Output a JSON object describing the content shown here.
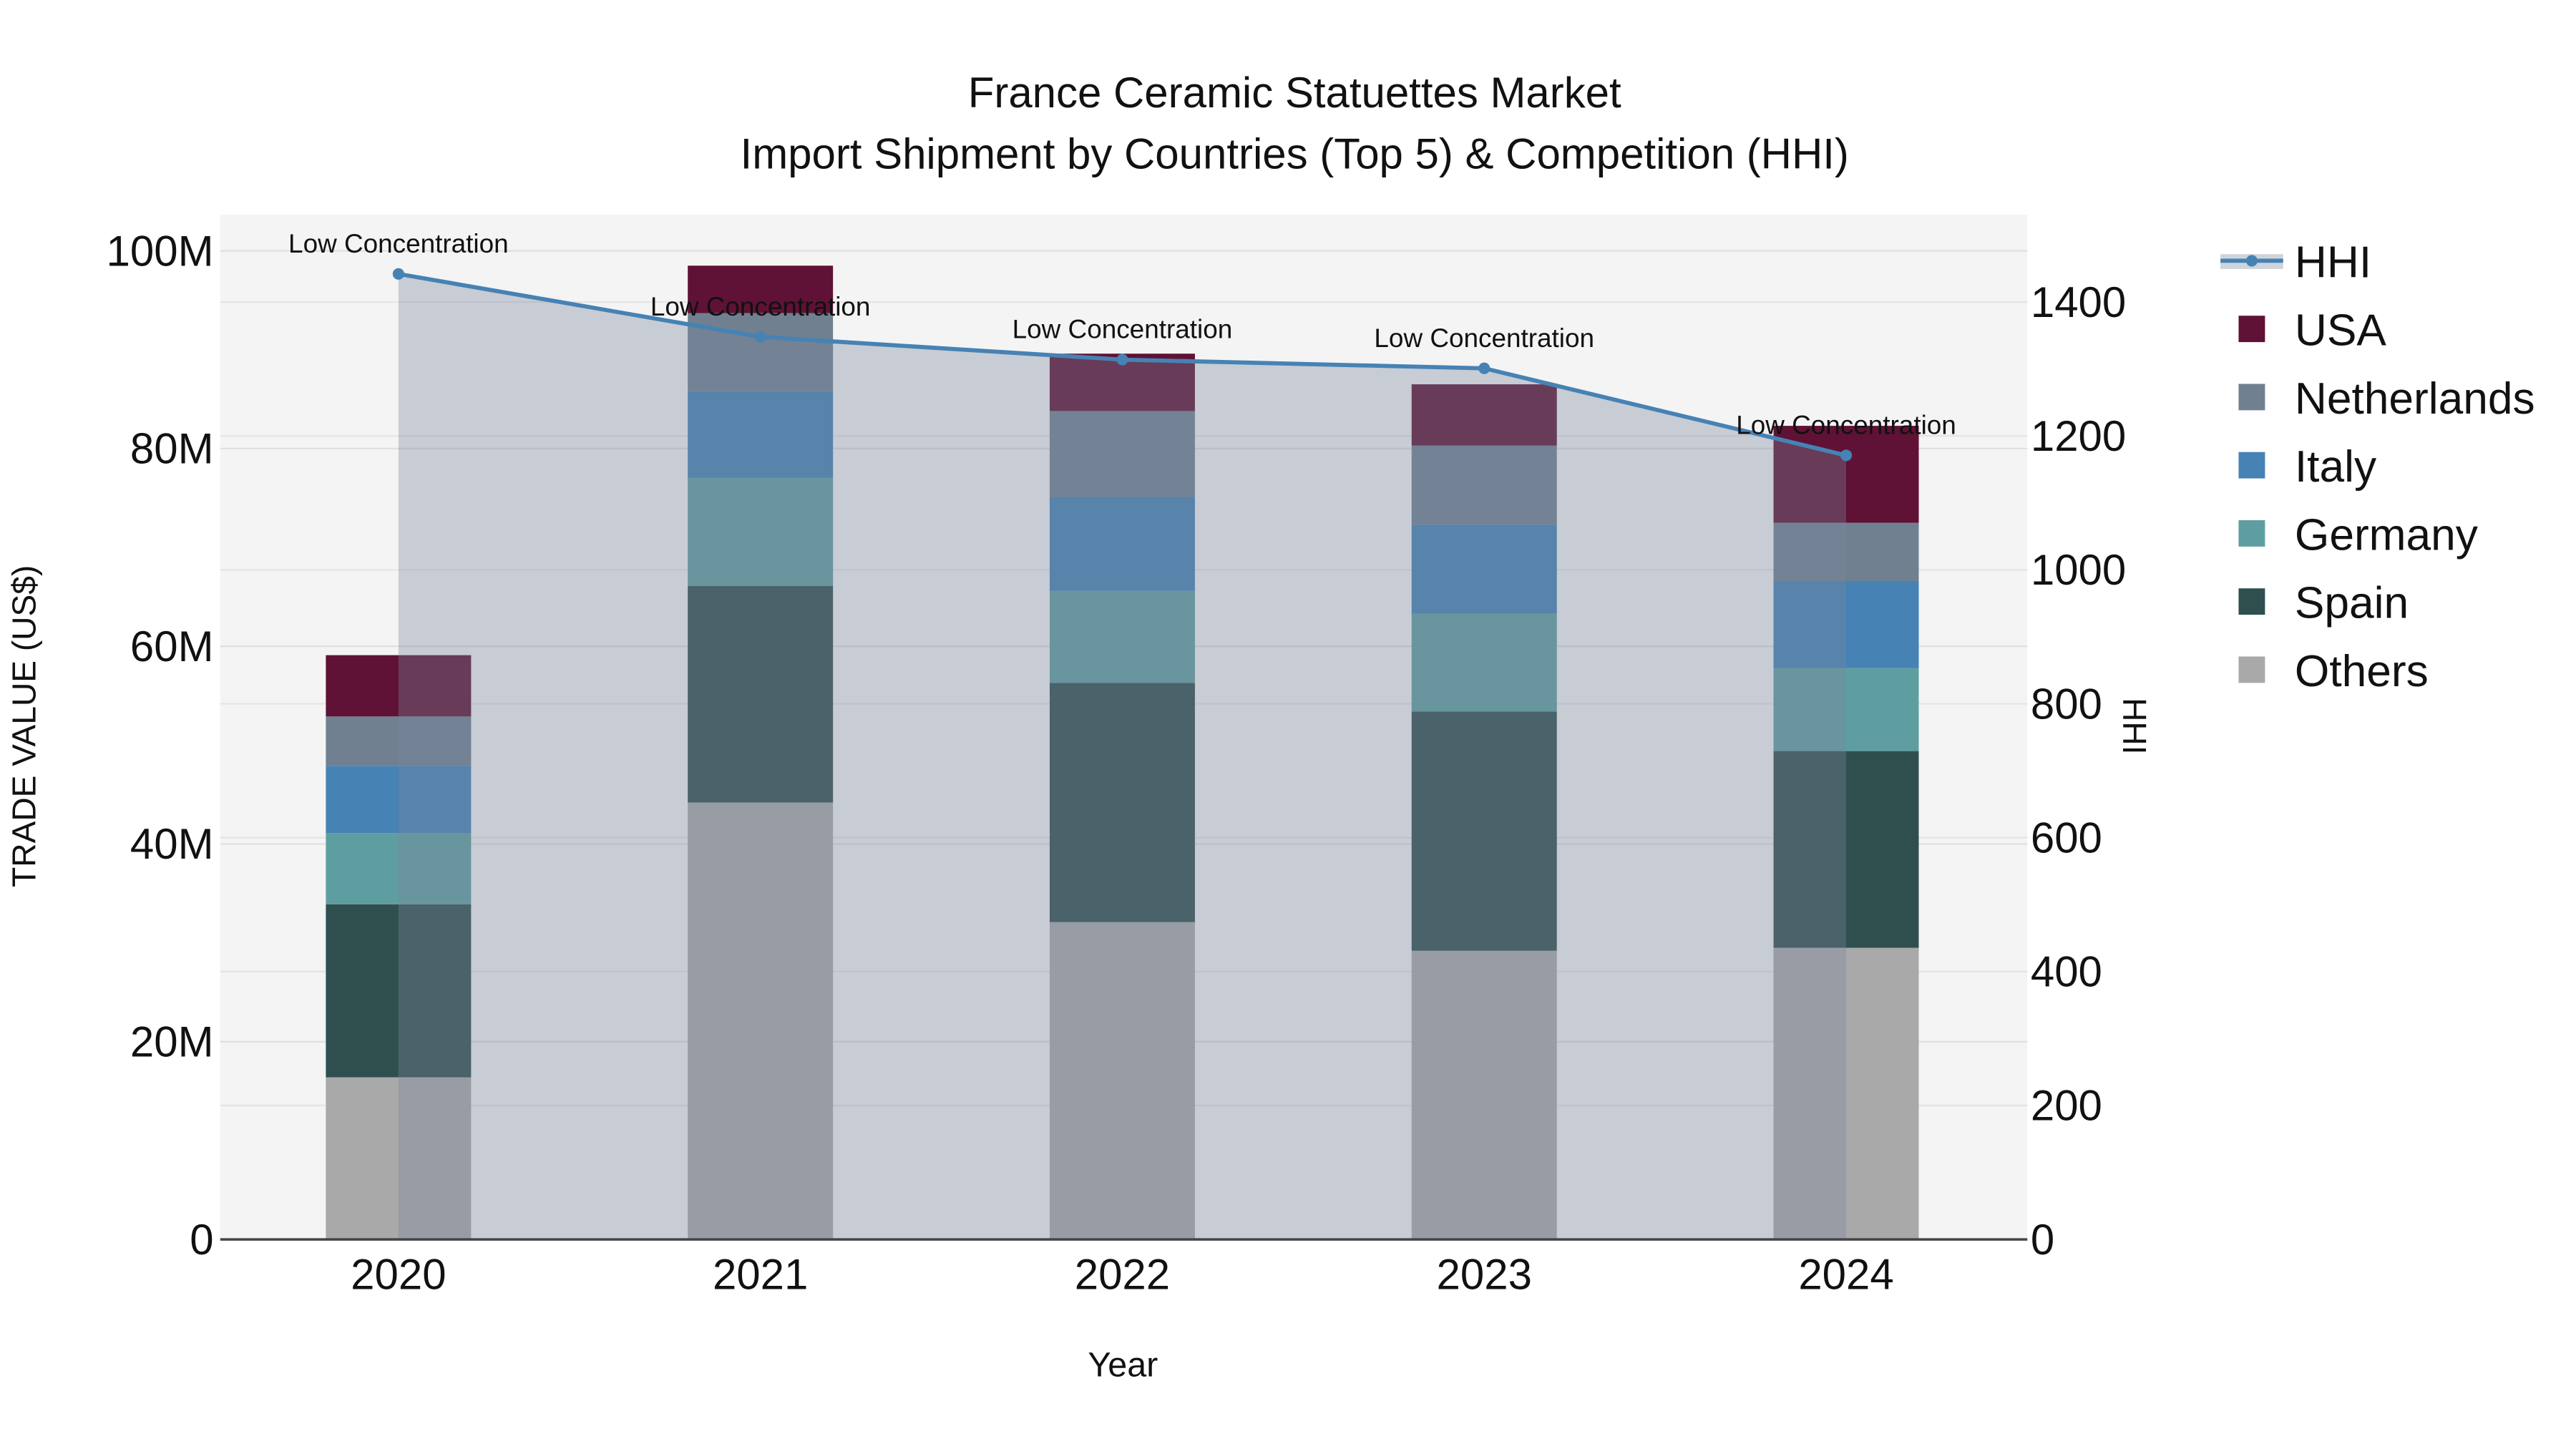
{
  "chart_data": {
    "type": "bar",
    "stacked": true,
    "title_line1": "France Ceramic Statuettes Market",
    "title_line2": "Import Shipment by Countries (Top 5) & Competition (HHI)",
    "xlabel": "Year",
    "ylabel": "TRADE VALUE (US$)",
    "y2label": "HHI",
    "categories": [
      "2020",
      "2021",
      "2022",
      "2023",
      "2024"
    ],
    "ylim": [
      0,
      104
    ],
    "y_ticks": [
      0,
      20,
      40,
      60,
      80,
      100
    ],
    "y_tick_labels": [
      "0",
      "20M",
      "40M",
      "60M",
      "80M",
      "100M"
    ],
    "y2lim": [
      0,
      1530
    ],
    "y2_ticks": [
      0,
      200,
      400,
      600,
      800,
      1000,
      1200,
      1400
    ],
    "y2_tick_labels": [
      "0",
      "200",
      "400",
      "600",
      "800",
      "1000",
      "1200",
      "1400"
    ],
    "value_unit": "million US$",
    "series": [
      {
        "name": "Others",
        "color": "#a9a9a9",
        "values": [
          16.4,
          44.2,
          32.1,
          29.2,
          29.5
        ]
      },
      {
        "name": "Spain",
        "color": "#2f4f4f",
        "values": [
          17.5,
          21.9,
          24.2,
          24.2,
          19.9
        ]
      },
      {
        "name": "Germany",
        "color": "#5f9ea0",
        "values": [
          7.2,
          10.9,
          9.3,
          9.9,
          8.4
        ]
      },
      {
        "name": "Italy",
        "color": "#4682b4",
        "values": [
          6.8,
          8.8,
          9.5,
          9.0,
          8.8
        ]
      },
      {
        "name": "Netherlands",
        "color": "#708090",
        "values": [
          5.0,
          7.9,
          8.7,
          8.0,
          5.9
        ]
      },
      {
        "name": "USA",
        "color": "#5f1235",
        "values": [
          6.2,
          4.8,
          5.8,
          6.2,
          9.8
        ]
      }
    ],
    "hhi": {
      "name": "HHI",
      "color": "#4682b4",
      "values": [
        1442,
        1348,
        1314,
        1301,
        1171
      ],
      "annotations": [
        "Low Concentration",
        "Low Concentration",
        "Low Concentration",
        "Low Concentration",
        "Low Concentration"
      ]
    },
    "legend": {
      "placement": "right",
      "entries": [
        "HHI",
        "USA",
        "Netherlands",
        "Italy",
        "Germany",
        "Spain",
        "Others"
      ]
    },
    "grid": true
  }
}
